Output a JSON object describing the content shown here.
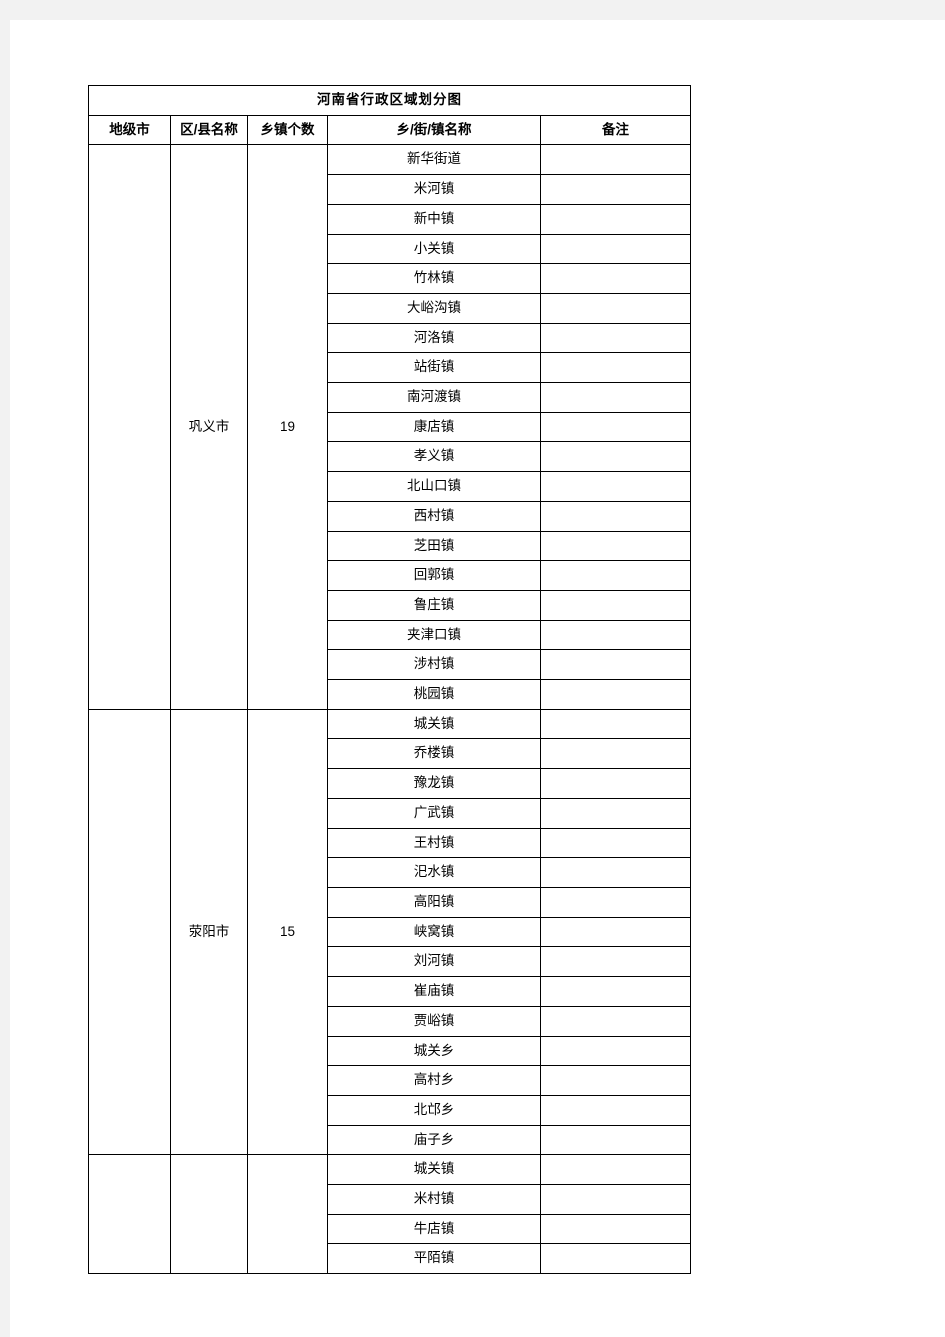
{
  "document": {
    "title": "河南省行政区域划分图"
  },
  "table": {
    "headers": {
      "city": "地级市",
      "district": "区/县名称",
      "count": "乡镇个数",
      "name": "乡/街/镇名称",
      "note": "备注"
    },
    "groups": [
      {
        "city": "",
        "district": "巩义市",
        "count": "19",
        "townships": [
          "新华街道",
          "米河镇",
          "新中镇",
          "小关镇",
          "竹林镇",
          "大峪沟镇",
          "河洛镇",
          "站街镇",
          "南河渡镇",
          "康店镇",
          "孝义镇",
          "北山口镇",
          "西村镇",
          "芝田镇",
          "回郭镇",
          "鲁庄镇",
          "夹津口镇",
          "涉村镇",
          "桃园镇"
        ],
        "notes": [
          "",
          "",
          "",
          "",
          "",
          "",
          "",
          "",
          "",
          "",
          "",
          "",
          "",
          "",
          "",
          "",
          "",
          "",
          ""
        ]
      },
      {
        "city": "",
        "district": "荥阳市",
        "count": "15",
        "townships": [
          "城关镇",
          "乔楼镇",
          "豫龙镇",
          "广武镇",
          "王村镇",
          "汜水镇",
          "高阳镇",
          "峡窝镇",
          "刘河镇",
          "崔庙镇",
          "贾峪镇",
          "城关乡",
          "高村乡",
          "北邙乡",
          "庙子乡"
        ],
        "notes": [
          "",
          "",
          "",
          "",
          "",
          "",
          "",
          "",
          "",
          "",
          "",
          "",
          "",
          "",
          ""
        ]
      },
      {
        "city": "",
        "district": "",
        "count": "",
        "townships": [
          "城关镇",
          "米村镇",
          "牛店镇",
          "平陌镇"
        ],
        "notes": [
          "",
          "",
          "",
          ""
        ]
      }
    ]
  }
}
